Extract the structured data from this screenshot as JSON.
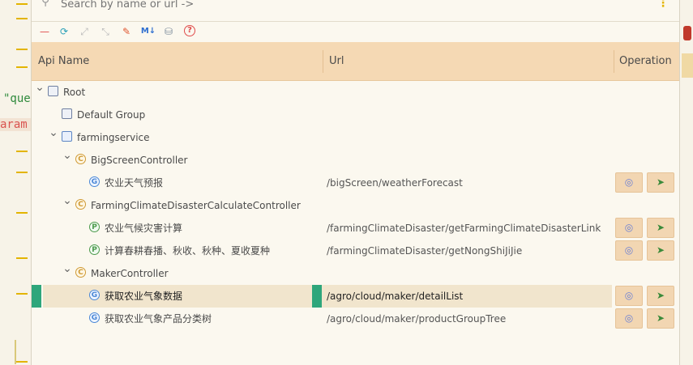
{
  "search": {
    "placeholder": "Search by name or url ->"
  },
  "gutter": {
    "code1": "\"que",
    "code2": "aram"
  },
  "toolbar": {
    "items": [
      {
        "icon": "minus-icon",
        "glyph": "—",
        "color": "#e04b4b"
      },
      {
        "icon": "refresh-icon",
        "glyph": "⟳",
        "color": "#2aa0b8"
      },
      {
        "icon": "expand-icon",
        "glyph": "⤢",
        "color": "#b9b9b9"
      },
      {
        "icon": "collapse-icon",
        "glyph": "⤡",
        "color": "#b9b9b9"
      },
      {
        "icon": "edit-icon",
        "glyph": "✎",
        "color": "#e0552f"
      },
      {
        "icon": "markdown-icon",
        "glyph": "M↓",
        "color": "#2f6fd0"
      },
      {
        "icon": "database-icon",
        "glyph": "⛁",
        "color": "#7a8a9a"
      },
      {
        "icon": "help-icon",
        "glyph": "?",
        "color": "#e04b4b"
      }
    ]
  },
  "header": {
    "api_name": "Api Name",
    "url": "Url",
    "operation": "Operation"
  },
  "tree": [
    {
      "name": "Root",
      "kind": "folder",
      "badge": "",
      "expanded": true,
      "url": ""
    },
    {
      "name": "Default Group",
      "kind": "folder",
      "badge": "",
      "url": ""
    },
    {
      "name": "farmingservice",
      "kind": "pkg",
      "badge": "",
      "expanded": true,
      "url": ""
    },
    {
      "name": "BigScreenController",
      "kind": "ctrl",
      "badge": "C",
      "expanded": true,
      "url": ""
    },
    {
      "name": "农业天气预报",
      "kind": "get",
      "badge": "G",
      "url": "/bigScreen/weatherForecast"
    },
    {
      "name": "FarmingClimateDisasterCalculateController",
      "kind": "ctrl",
      "badge": "C",
      "expanded": true,
      "url": ""
    },
    {
      "name": "农业气候灾害计算",
      "kind": "post",
      "badge": "P",
      "url": "/farmingClimateDisaster/getFarmingClimateDisasterLink"
    },
    {
      "name": "计算春耕春播、秋收、秋种、夏收夏种",
      "kind": "post",
      "badge": "P",
      "url": "/farmingClimateDisaster/getNongShiJiJie"
    },
    {
      "name": "MakerController",
      "kind": "ctrl",
      "badge": "C",
      "expanded": true,
      "url": ""
    },
    {
      "name": "获取农业气象数据",
      "kind": "get",
      "badge": "G",
      "url": "/agro/cloud/maker/detailList",
      "selected": true
    },
    {
      "name": "获取农业气象产品分类树",
      "kind": "get",
      "badge": "G",
      "url": "/agro/cloud/maker/productGroupTree"
    }
  ],
  "operation": {
    "view_icon": "◎",
    "send_icon": "➤"
  }
}
